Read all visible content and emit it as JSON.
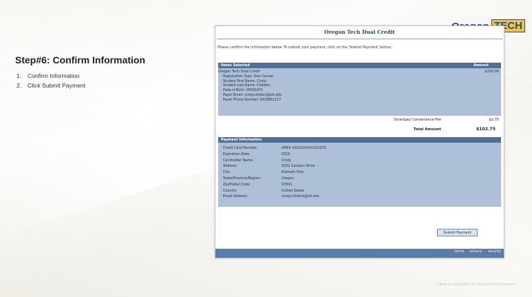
{
  "slide": {
    "step_title": "Step#6: Confirm Information",
    "steps": [
      {
        "num": "1.",
        "text": "Confirm Information"
      },
      {
        "num": "2.",
        "text": "Click Submit Payment"
      }
    ],
    "tagline": "Hands-on education for real-world achievement."
  },
  "logo": {
    "oregon": "Oregon",
    "tech": "TECH"
  },
  "panel": {
    "title": "Oregon Tech Dual Credit",
    "instructions": "Please confirm the information below. To submit your payment, click on the 'Submit Payment' button.",
    "items": {
      "header": "Items Selected",
      "amount_header": "Amount",
      "item_name": "Oregon Tech Dual Credit",
      "item_amount": "$100.00",
      "details": [
        "Registration Type: One Course",
        "Student First Name: Cindy",
        "Student Last Name: Childers",
        "Date of Birth: 05091971",
        "Payer Email: cindy.childers@oit.edu",
        "Payer Phone Number: 5418851217"
      ]
    },
    "fee": {
      "label": "Smartpay Convenience Fee",
      "value": "$2.75"
    },
    "total": {
      "label": "Total Amount",
      "value": "$102.75"
    },
    "payment": {
      "header": "Payment Information",
      "rows": [
        {
          "label": "Credit Card Number:",
          "value": "AMEX  XXXXXXXXXXX1075"
        },
        {
          "label": "Expiration Date:",
          "value": "0325"
        },
        {
          "label": "Cardholder Name:",
          "value": "Cindy"
        },
        {
          "label": "Address:",
          "value": "3201 Campus Drive"
        },
        {
          "label": "City:",
          "value": "Klamath Falls"
        },
        {
          "label": "State/Province/Region:",
          "value": "Oregon"
        },
        {
          "label": "Zip/Postal Code:",
          "value": "97601"
        },
        {
          "label": "Country:",
          "value": "United States"
        },
        {
          "label": "Email Address:",
          "value": "cindy.childers@oit.edu"
        }
      ]
    },
    "submit_label": "Submit Payment",
    "footer_links": [
      "terms",
      "privacy",
      "security"
    ]
  }
}
